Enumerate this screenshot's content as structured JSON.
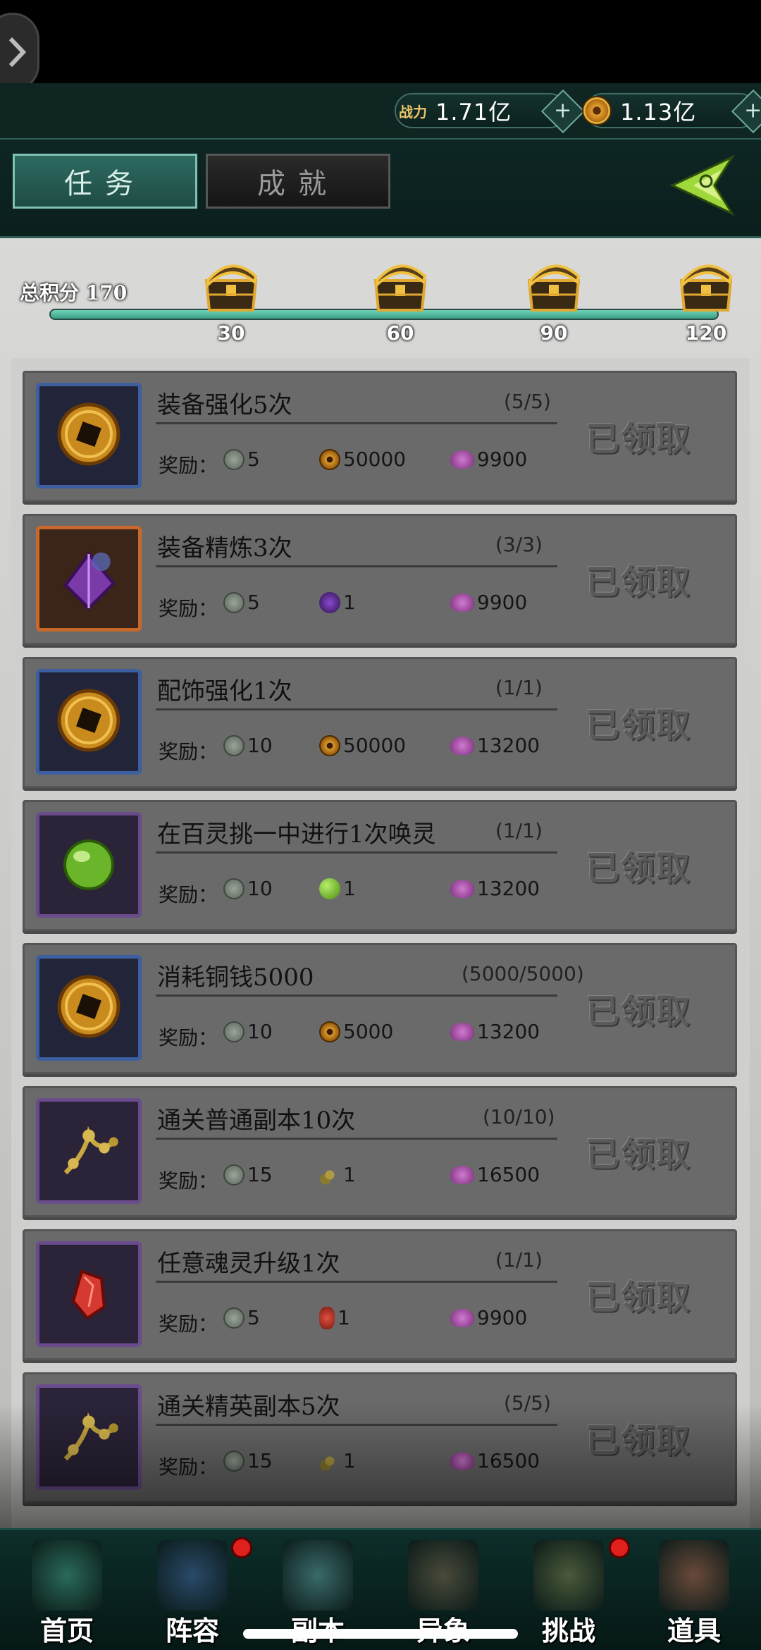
{
  "resources": {
    "power_label": "战力",
    "power_value": "1.71亿",
    "coin_value": "1.13亿"
  },
  "tabs": [
    {
      "label": "任务",
      "active": true
    },
    {
      "label": "成就",
      "active": false
    }
  ],
  "score": {
    "label": "总积分 170",
    "milestones": [
      "30",
      "60",
      "90",
      "120"
    ],
    "progress_fraction": 1.0
  },
  "tasks": [
    {
      "title": "装备强化5次",
      "progress": "(5/5)",
      "icon": "copper-coin-icon",
      "frame": "blue",
      "reward_label": "奖励：",
      "rewards": [
        {
          "icon": "jade-icon",
          "value": "5"
        },
        {
          "icon": "copper-coin-icon",
          "value": "50000"
        },
        {
          "icon": "lotus-icon",
          "value": "9900"
        }
      ],
      "status": "已领取"
    },
    {
      "title": "装备精炼3次",
      "progress": "(3/3)",
      "icon": "purple-stone-icon",
      "frame": "orange",
      "reward_label": "奖励：",
      "rewards": [
        {
          "icon": "jade-icon",
          "value": "5"
        },
        {
          "icon": "purple-stone-icon",
          "value": "1"
        },
        {
          "icon": "lotus-icon",
          "value": "9900"
        }
      ],
      "status": "已领取"
    },
    {
      "title": "配饰强化1次",
      "progress": "(1/1)",
      "icon": "copper-coin-icon",
      "frame": "blue",
      "reward_label": "奖励：",
      "rewards": [
        {
          "icon": "jade-icon",
          "value": "10"
        },
        {
          "icon": "copper-coin-icon",
          "value": "50000"
        },
        {
          "icon": "lotus-icon",
          "value": "13200"
        }
      ],
      "status": "已领取"
    },
    {
      "title": "在百灵挑一中进行1次唤灵",
      "progress": "(1/1)",
      "icon": "green-orb-icon",
      "frame": "purple",
      "reward_label": "奖励：",
      "rewards": [
        {
          "icon": "jade-icon",
          "value": "10"
        },
        {
          "icon": "green-orb-icon",
          "value": "1"
        },
        {
          "icon": "lotus-icon",
          "value": "13200"
        }
      ],
      "status": "已领取"
    },
    {
      "title": "消耗铜钱5000",
      "progress": "(5000/5000)",
      "icon": "copper-coin-icon",
      "frame": "blue",
      "reward_label": "奖励：",
      "rewards": [
        {
          "icon": "jade-icon",
          "value": "10"
        },
        {
          "icon": "copper-coin-icon",
          "value": "5000"
        },
        {
          "icon": "lotus-icon",
          "value": "13200"
        }
      ],
      "status": "已领取"
    },
    {
      "title": "通关普通副本10次",
      "progress": "(10/10)",
      "icon": "golden-herb-icon",
      "frame": "purple",
      "reward_label": "奖励：",
      "rewards": [
        {
          "icon": "jade-icon",
          "value": "15"
        },
        {
          "icon": "golden-herb-icon",
          "value": "1"
        },
        {
          "icon": "lotus-icon",
          "value": "16500"
        }
      ],
      "status": "已领取"
    },
    {
      "title": "任意魂灵升级1次",
      "progress": "(1/1)",
      "icon": "red-crystal-icon",
      "frame": "purple",
      "reward_label": "奖励：",
      "rewards": [
        {
          "icon": "jade-icon",
          "value": "5"
        },
        {
          "icon": "red-crystal-icon",
          "value": "1"
        },
        {
          "icon": "lotus-icon",
          "value": "9900"
        }
      ],
      "status": "已领取"
    },
    {
      "title": "通关精英副本5次",
      "progress": "(5/5)",
      "icon": "golden-herb-icon",
      "frame": "purple",
      "reward_label": "奖励：",
      "rewards": [
        {
          "icon": "jade-icon",
          "value": "15"
        },
        {
          "icon": "golden-herb-icon",
          "value": "1"
        },
        {
          "icon": "lotus-icon",
          "value": "16500"
        }
      ],
      "status": "已领取"
    }
  ],
  "nav": [
    {
      "label": "首页",
      "icon": "pagoda-icon",
      "badge": false
    },
    {
      "label": "阵容",
      "icon": "team-icon",
      "badge": true
    },
    {
      "label": "副本",
      "icon": "sword-icon",
      "badge": false
    },
    {
      "label": "异象",
      "icon": "crossed-swords-icon",
      "badge": false
    },
    {
      "label": "挑战",
      "icon": "scroll-map-icon",
      "badge": true
    },
    {
      "label": "道具",
      "icon": "bag-icon",
      "badge": false
    }
  ]
}
